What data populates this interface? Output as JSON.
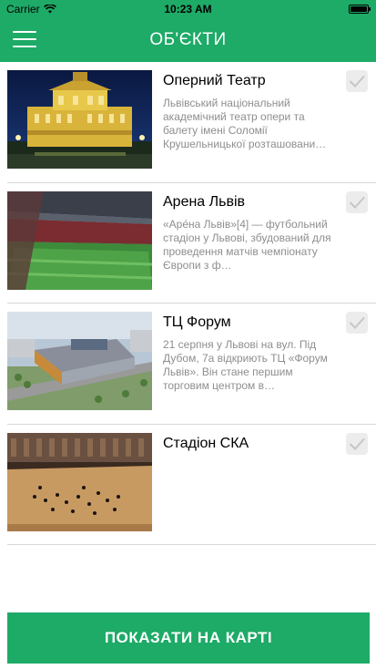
{
  "status": {
    "carrier": "Carrier",
    "time": "10:23 AM"
  },
  "header": {
    "title": "ОБ'ЄКТИ"
  },
  "items": [
    {
      "name": "Оперний Театр",
      "description": "Львівський національний академічний театр опери та балету імені Соломії Крушельницької розташовани…",
      "checked": false
    },
    {
      "name": "Арена Львів",
      "description": "«Аре́на Львів»[4] — футбольний стадіон у Львові, збудований для проведення матчів чемпіонату Європи з ф…",
      "checked": false
    },
    {
      "name": "ТЦ Форум",
      "description": "21 серпня у Львові на вул. Під Дубом, 7а відкриють ТЦ «Форум Львів». Він стане першим торговим центром в…",
      "checked": false
    },
    {
      "name": "Стадіон СКА",
      "description": "",
      "checked": false
    }
  ],
  "footer": {
    "button_label": "ПОКАЗАТИ НА КАРТІ"
  },
  "colors": {
    "accent": "#1eaa67",
    "checkbox": "#ececec",
    "check": "#c6c6c6"
  }
}
